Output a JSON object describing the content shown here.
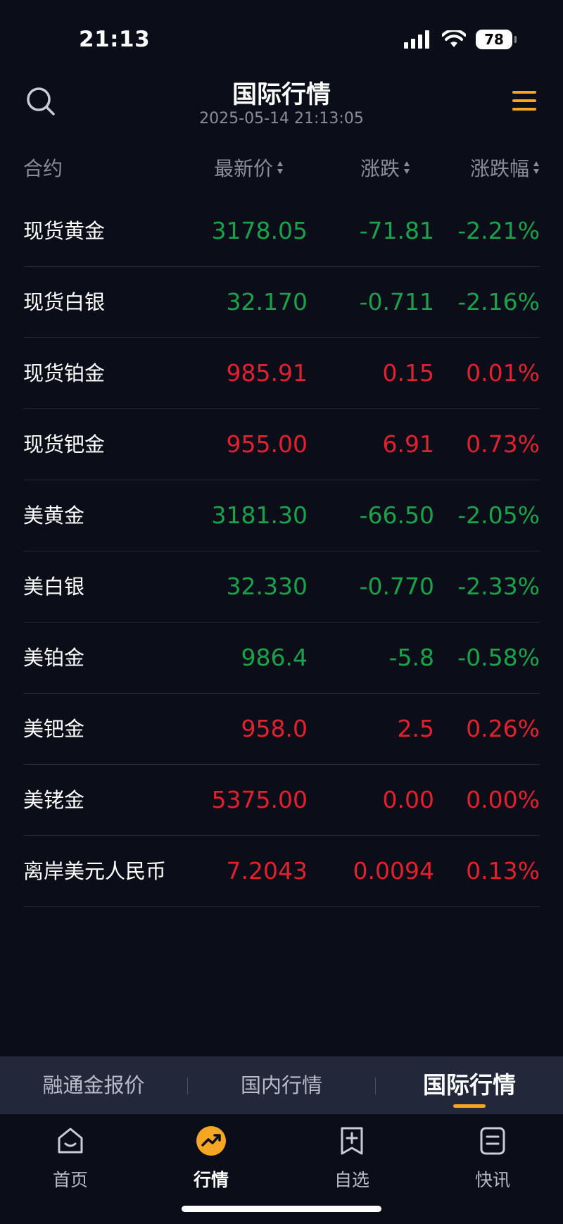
{
  "status_bar": {
    "time": "21:13",
    "battery": "78"
  },
  "header": {
    "title": "国际行情",
    "timestamp": "2025-05-14 21:13:05"
  },
  "columns": {
    "name": "合约",
    "price": "最新价",
    "change": "涨跌",
    "pct": "涨跌幅"
  },
  "colors": {
    "up": "#e4202f",
    "down": "#16a34a",
    "accent": "#f5a623"
  },
  "rows": [
    {
      "name": "现货黄金",
      "price": "3178.05",
      "change": "-71.81",
      "pct": "-2.21%",
      "dir": "down"
    },
    {
      "name": "现货白银",
      "price": "32.170",
      "change": "-0.711",
      "pct": "-2.16%",
      "dir": "down"
    },
    {
      "name": "现货铂金",
      "price": "985.91",
      "change": "0.15",
      "pct": "0.01%",
      "dir": "up"
    },
    {
      "name": "现货钯金",
      "price": "955.00",
      "change": "6.91",
      "pct": "0.73%",
      "dir": "up"
    },
    {
      "name": "美黄金",
      "price": "3181.30",
      "change": "-66.50",
      "pct": "-2.05%",
      "dir": "down"
    },
    {
      "name": "美白银",
      "price": "32.330",
      "change": "-0.770",
      "pct": "-2.33%",
      "dir": "down"
    },
    {
      "name": "美铂金",
      "price": "986.4",
      "change": "-5.8",
      "pct": "-0.58%",
      "dir": "down"
    },
    {
      "name": "美钯金",
      "price": "958.0",
      "change": "2.5",
      "pct": "0.26%",
      "dir": "up"
    },
    {
      "name": "美铑金",
      "price": "5375.00",
      "change": "0.00",
      "pct": "0.00%",
      "dir": "up"
    },
    {
      "name": "离岸美元人民币",
      "price": "7.2043",
      "change": "0.0094",
      "pct": "0.13%",
      "dir": "up"
    }
  ],
  "sub_tabs": [
    {
      "label": "融通金报价"
    },
    {
      "label": "国内行情"
    },
    {
      "label": "国际行情",
      "active": true
    }
  ],
  "bottom_nav": [
    {
      "label": "首页",
      "icon": "home-icon"
    },
    {
      "label": "行情",
      "icon": "market-icon",
      "active": true
    },
    {
      "label": "自选",
      "icon": "watchlist-icon"
    },
    {
      "label": "快讯",
      "icon": "news-icon"
    }
  ]
}
